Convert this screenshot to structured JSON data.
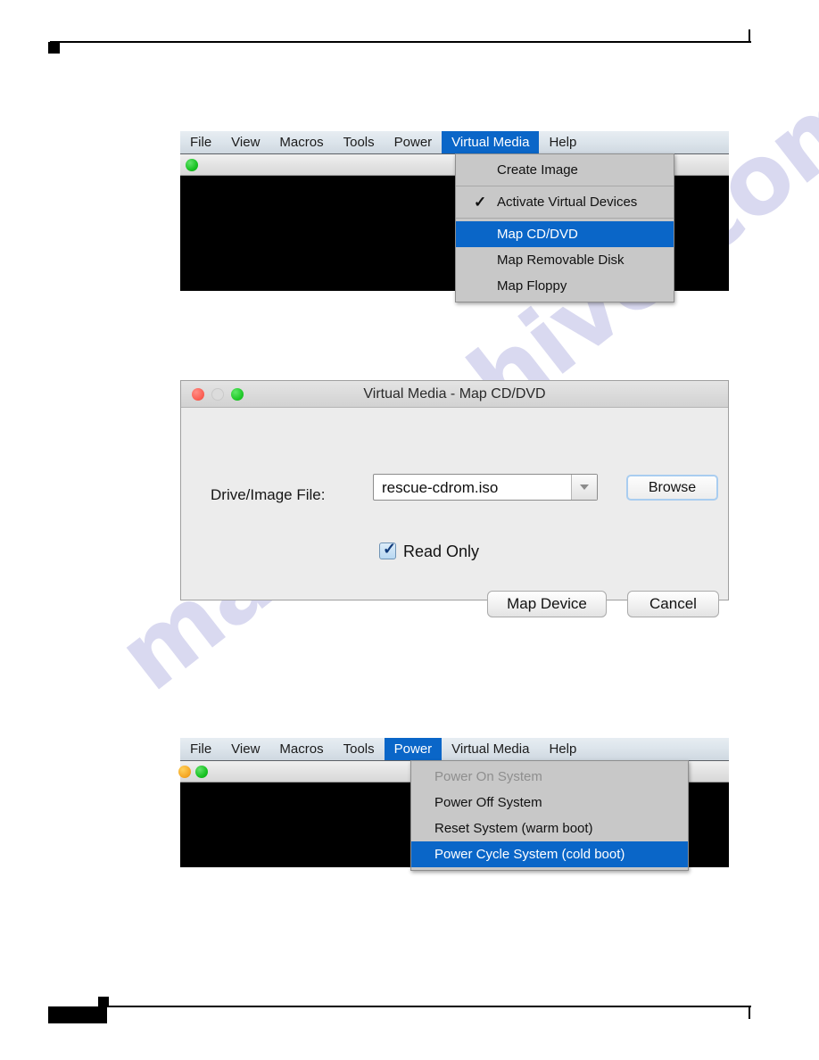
{
  "page": {
    "watermark_text": "manualshive.com"
  },
  "figure1": {
    "name": "Virtual Media menu open in KVM console",
    "menubar": [
      {
        "label": "File",
        "active": false
      },
      {
        "label": "View",
        "active": false
      },
      {
        "label": "Macros",
        "active": false
      },
      {
        "label": "Tools",
        "active": false
      },
      {
        "label": "Power",
        "active": false
      },
      {
        "label": "Virtual Media",
        "active": true
      },
      {
        "label": "Help",
        "active": false
      }
    ],
    "status_leds": [
      {
        "color_name": "green",
        "hex": "#18c222"
      }
    ],
    "dropdown": {
      "items": [
        {
          "label": "Create Image",
          "checked": false,
          "highlight": false,
          "disabled": false
        },
        {
          "separator": true
        },
        {
          "label": "Activate Virtual Devices",
          "checked": true,
          "highlight": false,
          "disabled": false
        },
        {
          "separator": true
        },
        {
          "label": "Map CD/DVD",
          "checked": false,
          "highlight": true,
          "disabled": false
        },
        {
          "label": "Map Removable Disk",
          "checked": false,
          "highlight": false,
          "disabled": false
        },
        {
          "label": "Map Floppy",
          "checked": false,
          "highlight": false,
          "disabled": false
        }
      ]
    }
  },
  "figure2": {
    "name": "Virtual Media Map CD/DVD dialog",
    "title": "Virtual Media - Map CD/DVD",
    "traffic_lights": [
      {
        "name": "close",
        "hex": "#fb6055",
        "enabled": true
      },
      {
        "name": "minimize",
        "hex": "#dcdcdc",
        "enabled": false
      },
      {
        "name": "zoom",
        "hex": "#21c92a",
        "enabled": true
      }
    ],
    "drive_field": {
      "label": "Drive/Image File:",
      "value": "rescue-cdrom.iso",
      "placeholder": "rescue-cdrom.iso"
    },
    "browse_label": "Browse",
    "read_only": {
      "label": "Read Only",
      "checked": true,
      "check_glyph": "✓"
    },
    "map_device_label": "Map Device",
    "cancel_label": "Cancel"
  },
  "figure3": {
    "name": "Power menu open in KVM console",
    "menubar": [
      {
        "label": "File",
        "active": false
      },
      {
        "label": "View",
        "active": false
      },
      {
        "label": "Macros",
        "active": false
      },
      {
        "label": "Tools",
        "active": false
      },
      {
        "label": "Power",
        "active": true
      },
      {
        "label": "Virtual Media",
        "active": false
      },
      {
        "label": "Help",
        "active": false
      }
    ],
    "status_leds": [
      {
        "color_name": "orange",
        "hex": "#f5a623"
      },
      {
        "color_name": "green",
        "hex": "#18c222"
      }
    ],
    "dropdown": {
      "items": [
        {
          "label": "Power On System",
          "highlight": false,
          "disabled": true
        },
        {
          "label": "Power Off System",
          "highlight": false,
          "disabled": false
        },
        {
          "label": "Reset System (warm boot)",
          "highlight": false,
          "disabled": false
        },
        {
          "label": "Power Cycle System (cold boot)",
          "highlight": true,
          "disabled": false
        }
      ]
    }
  },
  "colors": {
    "menu_highlight": "#0a66c8",
    "menu_panel": "#c8c8c8",
    "menubar_top": "#e7edf2",
    "viewport": "#000000",
    "dialog_face": "#ececec",
    "watermark": "#d9d9f0"
  }
}
